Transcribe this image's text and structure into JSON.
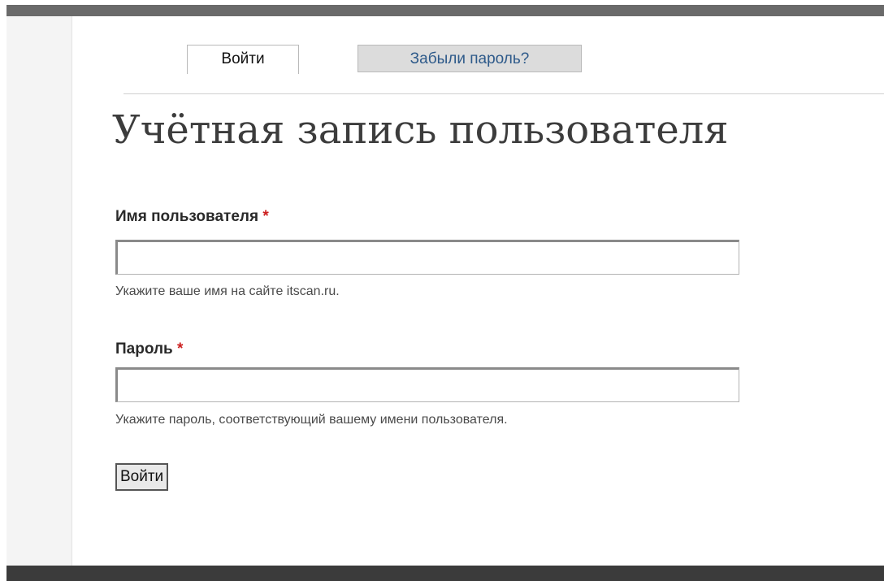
{
  "tabs": {
    "login": "Войти",
    "forgot_password": "Забыли пароль?"
  },
  "page": {
    "title": "Учётная запись пользователя"
  },
  "form": {
    "username": {
      "label": "Имя пользователя",
      "required_mark": "*",
      "value": "",
      "description": "Укажите ваше имя на сайте itscan.ru."
    },
    "password": {
      "label": "Пароль",
      "required_mark": "*",
      "value": "",
      "description": "Укажите пароль, соответствующий вашему имени пользователя."
    },
    "submit_label": "Войти"
  },
  "colors": {
    "top_bar": "#6a6a6a",
    "bottom_bar": "#3b3b3b",
    "link": "#2e5a8a",
    "required": "#cc1f1f"
  }
}
